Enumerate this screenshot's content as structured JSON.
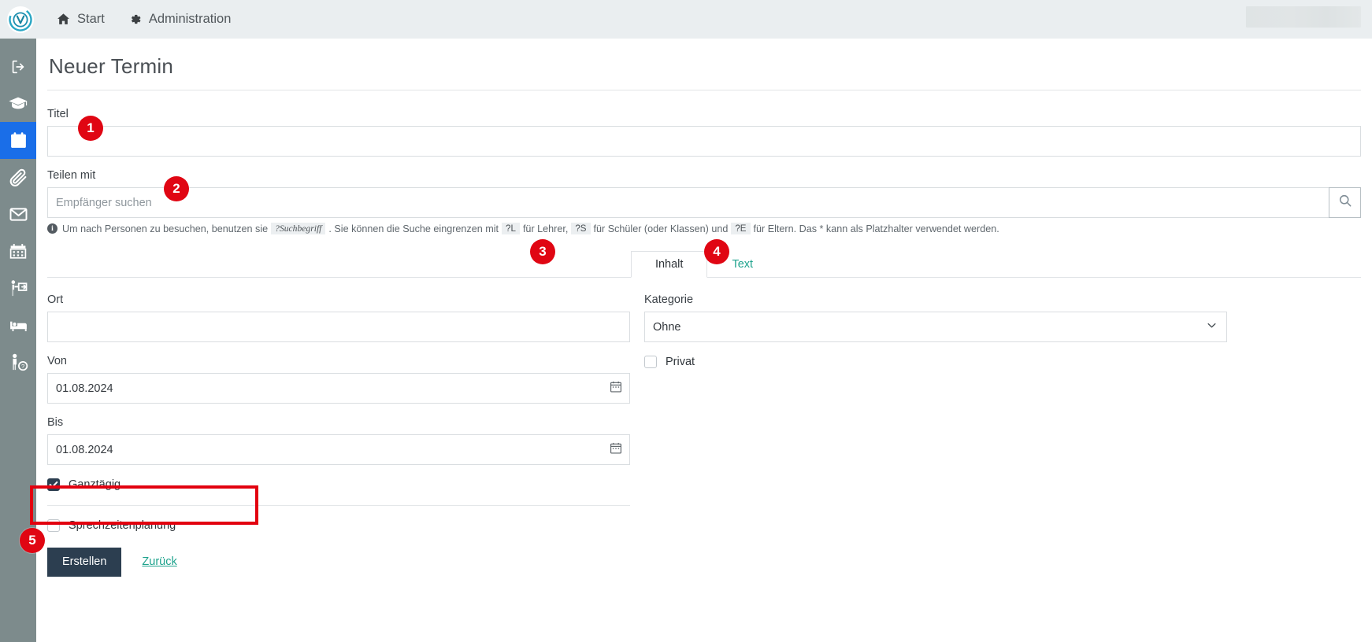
{
  "topbar": {
    "logo_name": "app-logo",
    "nav": [
      {
        "label": "Start",
        "icon": "home-icon"
      },
      {
        "label": "Administration",
        "icon": "gear-icon"
      }
    ],
    "redacted_label": ""
  },
  "sidebar": {
    "items": [
      {
        "name": "logout",
        "icon": "logout-icon",
        "active": false
      },
      {
        "name": "graduation",
        "icon": "graduation-cap-icon",
        "active": false
      },
      {
        "name": "calendar",
        "icon": "calendar-filled-icon",
        "active": true
      },
      {
        "name": "attachments",
        "icon": "paperclip-icon",
        "active": false
      },
      {
        "name": "messages",
        "icon": "envelope-icon",
        "active": false
      },
      {
        "name": "schedule",
        "icon": "calendar-grid-icon",
        "active": false
      },
      {
        "name": "teaching",
        "icon": "presenter-icon",
        "active": false
      },
      {
        "name": "boarding",
        "icon": "bed-icon",
        "active": false
      },
      {
        "name": "person-help",
        "icon": "person-question-icon",
        "active": false
      }
    ],
    "active_color": "#1a6ee8",
    "background_color": "#7d8b8c"
  },
  "page": {
    "title": "Neuer Termin"
  },
  "form": {
    "titel": {
      "label": "Titel",
      "value": "",
      "placeholder": ""
    },
    "teilen_mit": {
      "label": "Teilen mit",
      "value": "",
      "placeholder": "Empfänger suchen",
      "search_icon": "search-icon"
    },
    "hint": {
      "part1": "Um nach Personen zu besuchen, benutzen sie",
      "code1": "?Suchbegriff",
      "part2": ". Sie können die Suche eingrenzen mit",
      "code2": "?L",
      "part3": "für Lehrer,",
      "code3": "?S",
      "part4": "für Schüler (oder Klassen) und",
      "code4": "?E",
      "part5": "für Eltern. Das * kann als Platzhalter verwendet werden."
    },
    "tabs": [
      {
        "label": "Inhalt",
        "active": true
      },
      {
        "label": "Text",
        "active": false
      }
    ],
    "ort": {
      "label": "Ort",
      "value": "",
      "placeholder": ""
    },
    "von": {
      "label": "Von",
      "value": "01.08.2024",
      "icon": "calendar-picker-icon"
    },
    "bis": {
      "label": "Bis",
      "value": "01.08.2024",
      "icon": "calendar-picker-icon"
    },
    "ganztaegig": {
      "label": "Ganztägig",
      "checked": true
    },
    "sprechzeitenplanung": {
      "label": "Sprechzeitenplanung",
      "checked": false
    },
    "kategorie": {
      "label": "Kategorie",
      "value": "Ohne",
      "options": [
        "Ohne"
      ]
    },
    "privat": {
      "label": "Privat",
      "checked": false
    }
  },
  "actions": {
    "submit": "Erstellen",
    "back": "Zurück"
  },
  "annotations": {
    "badges": [
      {
        "number": "1",
        "target": "titel-input"
      },
      {
        "number": "2",
        "target": "teilen-mit-input"
      },
      {
        "number": "3",
        "target": "tab-inhalt"
      },
      {
        "number": "4",
        "target": "tab-text"
      },
      {
        "number": "5",
        "target": "erstellen-button"
      }
    ],
    "highlight_box": {
      "target": "sprechzeitenplanung-row",
      "color": "#e2000f"
    },
    "badge_color": "#e00613"
  }
}
